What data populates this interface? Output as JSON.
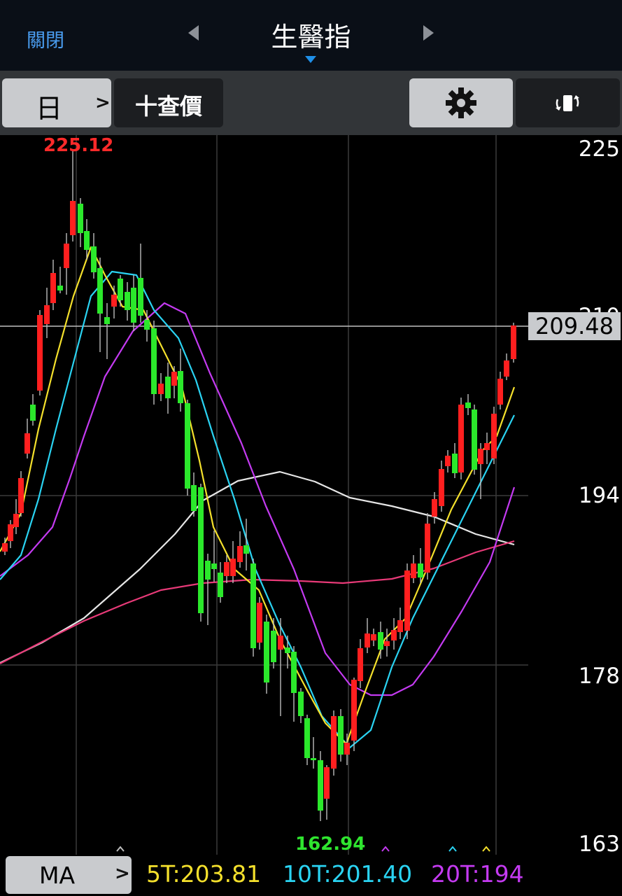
{
  "header": {
    "close_label": "關閉",
    "title": "生醫指"
  },
  "toolbar": {
    "period_label": "日",
    "crosshair_label": "十查價",
    "icons": [
      "chevron-right-icon",
      "gear-icon",
      "rotate-screen-icon"
    ]
  },
  "chart": {
    "y_ticks": [
      "225",
      "210",
      "194",
      "178",
      "163"
    ],
    "current_price": "209.48",
    "high_label": "225.12",
    "low_label": "162.94",
    "colors": {
      "up": "#ff1f1f",
      "down": "#2be82b",
      "ma5": "#f4e02c",
      "ma10": "#2ad3f2",
      "ma20": "#c43af1",
      "ma60": "#e6e6e6",
      "ma120": "#e83a78"
    }
  },
  "chart_data": {
    "type": "candlestick",
    "ylim": [
      163,
      225
    ],
    "series": [
      {
        "name": "5T",
        "values": []
      },
      {
        "name": "10T",
        "values": []
      },
      {
        "name": "20T",
        "values": []
      }
    ]
  },
  "bottom": {
    "ma_label": "MA",
    "ma5": "5T:203.81",
    "ma10": "10T:201.40",
    "ma20": "20T:194"
  }
}
